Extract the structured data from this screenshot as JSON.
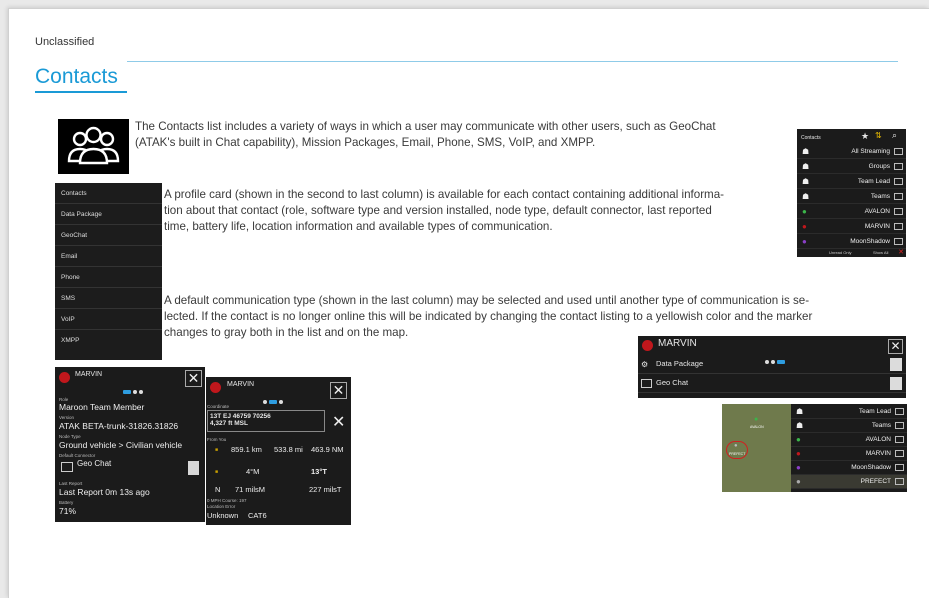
{
  "header": {
    "classification": "Unclassified",
    "title": "Contacts"
  },
  "paragraphs": {
    "p1_line1": "The Contacts list includes a variety of ways in which a user may communicate with other users, such as GeoChat",
    "p1_line2": "(ATAK's built in Chat capability), Mission Packages, Email, Phone, SMS, VoIP, and XMPP.",
    "p2_line1": "A profile card (shown in the second to last column) is available for each contact containing additional informa-",
    "p2_line2": "tion about that contact (role, software type and version installed, node type, default connector, last reported",
    "p2_line3": "time, battery life, location information and available types of communication.",
    "p3_line1": "A default communication type (shown in the last column) may be selected and used until another type of communication is se-",
    "p3_line2": "lected. If the contact is no longer online this will be indicated by changing the contact listing to a yellowish color and the marker",
    "p3_line3": "changes to gray both in the list and on the map."
  },
  "menu": [
    "Contacts",
    "Data Package",
    "GeoChat",
    "Email",
    "Phone",
    "SMS",
    "VoIP",
    "XMPP"
  ],
  "contact_list": {
    "title": "Contacts",
    "rows": [
      "All Streaming",
      "Groups",
      "Team Lead",
      "Teams",
      "AVALON",
      "MARVIN",
      "MoonShadow"
    ],
    "footer_unread": "Unread Only",
    "footer_showall": "Show All"
  },
  "profile_card": {
    "name": "MARVIN",
    "role_label": "Role",
    "role": "Maroon Team Member",
    "version_label": "Version",
    "version": "ATAK BETA-trunk-31826.31826",
    "node_label": "Node Type",
    "node": "Ground vehicle > Civilian vehicle",
    "connector_label": "Default Connector",
    "connector": "Geo Chat",
    "report_label": "Last Report",
    "report": "Last Report 0m 13s ago",
    "battery_label": "Battery",
    "battery": "71%"
  },
  "location_card": {
    "name": "MARVIN",
    "coord_label": "Coordinate",
    "coord1": "13T EJ 46759 70256",
    "coord2": "4,327 ft MSL",
    "from_label": "From You",
    "r1_a": "859.1 km",
    "r1_b": "533.8 mi",
    "r1_c": "463.9 NM",
    "r2_a": "4°M",
    "r2_b": "13°T",
    "r3_prefix": "N",
    "r3_a": "71 milsM",
    "r3_b": "227 milsT",
    "speed": "0 MPH Course: 197",
    "err_label": "Location Error",
    "err": "Unknown",
    "err2": "CAT6"
  },
  "marvin_card": {
    "name": "MARVIN",
    "rows": [
      "Data Package",
      "Geo Chat"
    ]
  },
  "map_list": {
    "rows": [
      "Team Lead",
      "Teams",
      "AVALON",
      "MARVIN",
      "MoonShadow",
      "PREFECT"
    ],
    "map_labels": [
      "AVALON",
      "PREFECT"
    ]
  },
  "colors": {
    "accent": "#1a9ad6",
    "panel": "#1b1b1b",
    "selected": "#2e9de0"
  }
}
